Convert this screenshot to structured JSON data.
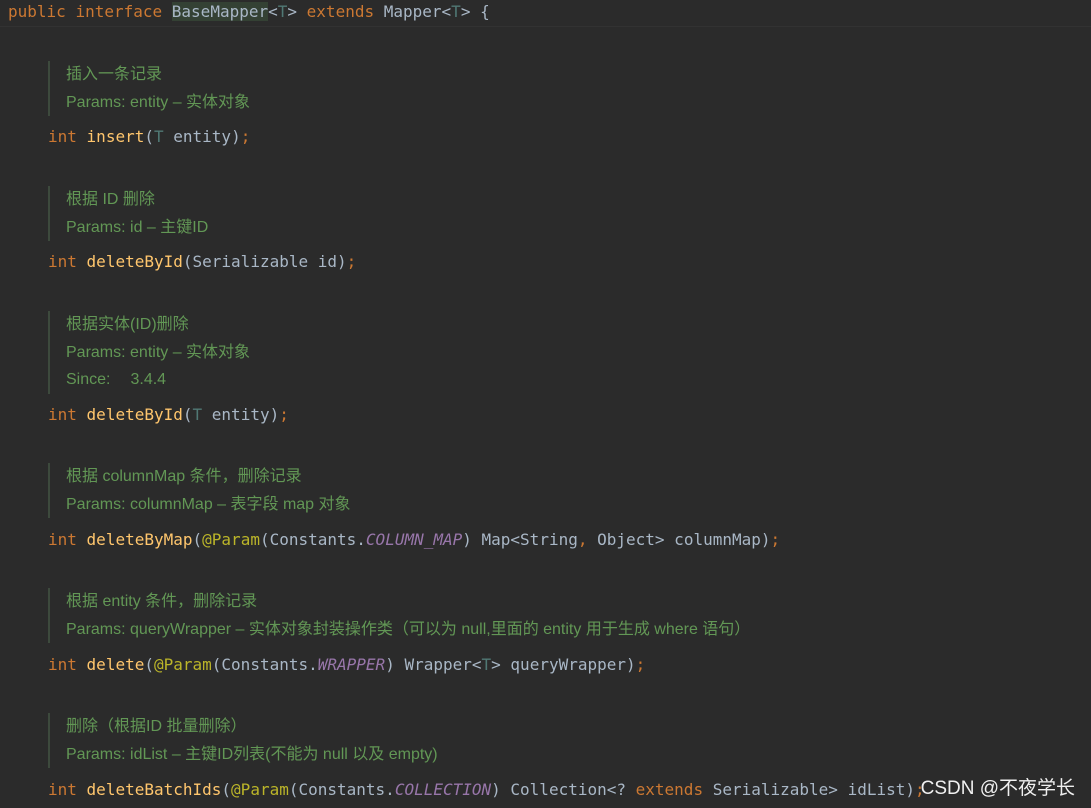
{
  "header": {
    "public": "public",
    "interface": "interface",
    "name": "BaseMapper",
    "lt": "<",
    "generic": "T",
    "gt": ">",
    "extends": " extends ",
    "parent": "Mapper",
    "brace": " {"
  },
  "methods": [
    {
      "doc": {
        "summary": "插入一条记录",
        "params": "Params: entity – 实体对象"
      },
      "code": {
        "ret": "int",
        "name": "insert",
        "open": "(",
        "t": "T",
        "args": " entity",
        "close": ")",
        "semi": ";"
      }
    },
    {
      "doc": {
        "summary": "根据 ID 删除",
        "params": "Params: id – 主键ID"
      },
      "code": {
        "ret": "int",
        "name": "deleteById",
        "open": "(",
        "args": "Serializable id",
        "close": ")",
        "semi": ";"
      }
    },
    {
      "doc": {
        "summary": "根据实体(ID)删除",
        "params": "Params: entity – 实体对象",
        "since_label": "Since:",
        "since_value": "3.4.4"
      },
      "code": {
        "ret": "int",
        "name": "deleteById",
        "open": "(",
        "t": "T",
        "args": " entity",
        "close": ")",
        "semi": ";"
      }
    },
    {
      "doc": {
        "summary": "根据 columnMap 条件，删除记录",
        "params": "Params: columnMap – 表字段 map 对象"
      },
      "code": {
        "ret": "int",
        "name": "deleteByMap",
        "open": "(",
        "ann": "@Param",
        "ann_open": "(Constants.",
        "const": "COLUMN_MAP",
        "ann_close": ") Map<String",
        "comma": ",",
        "rest": " Object> columnMap)",
        "semi": ";"
      }
    },
    {
      "doc": {
        "summary": "根据 entity 条件，删除记录",
        "params": "Params: queryWrapper – 实体对象封装操作类（可以为 null,里面的 entity 用于生成 where 语句）"
      },
      "code": {
        "ret": "int",
        "name": "delete",
        "open": "(",
        "ann": "@Param",
        "ann_open": "(Constants.",
        "const": "WRAPPER",
        "ann_close": ") Wrapper<",
        "t": "T",
        "rest": "> queryWrapper)",
        "semi": ";"
      }
    },
    {
      "doc": {
        "summary": "删除（根据ID 批量删除）",
        "params": "Params: idList – 主键ID列表(不能为 null 以及 empty)"
      },
      "code": {
        "ret": "int",
        "name": "deleteBatchIds",
        "open": "(",
        "ann": "@Param",
        "ann_open": "(Constants.",
        "const": "COLLECTION",
        "ann_close": ") Collection<? ",
        "ext": "extends",
        "rest": " Serializable> idList)",
        "semi": ";"
      }
    }
  ],
  "watermark": "CSDN @不夜学长",
  "colors": {
    "background": "#2b2b2b",
    "keyword": "#cc7832",
    "function": "#ffc66d",
    "type_param": "#507874",
    "annotation": "#bbb529",
    "static_field": "#9876aa",
    "doc_text": "#629755",
    "plain": "#a9b7c6"
  }
}
